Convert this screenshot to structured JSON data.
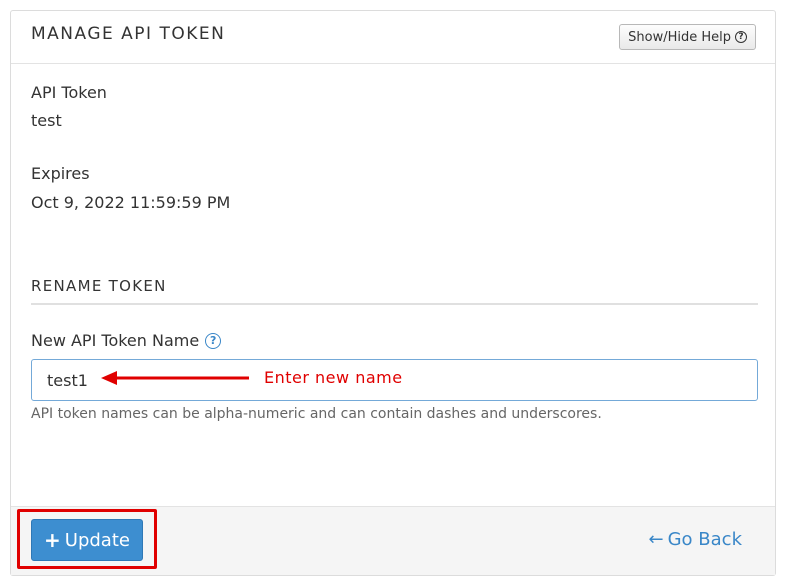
{
  "header": {
    "title": "MANAGE API TOKEN",
    "help_button": "Show/Hide Help",
    "help_icon": "question-circle-icon"
  },
  "token": {
    "label": "API Token",
    "value": "test"
  },
  "expires": {
    "label": "Expires",
    "value": "Oct 9, 2022 11:59:59 PM"
  },
  "rename": {
    "section_title": "RENAME TOKEN",
    "input_label": "New API Token Name",
    "input_value": "test1",
    "hint": "API token names can be alpha-numeric and can contain dashes and underscores.",
    "annotation": "Enter new name"
  },
  "footer": {
    "update_label": "Update",
    "update_icon": "plus-icon",
    "go_back_label": "Go Back",
    "go_back_icon": "arrow-left-icon"
  },
  "colors": {
    "primary": "#3d8ed0",
    "link": "#3a87c8",
    "annotation": "#e00000"
  }
}
